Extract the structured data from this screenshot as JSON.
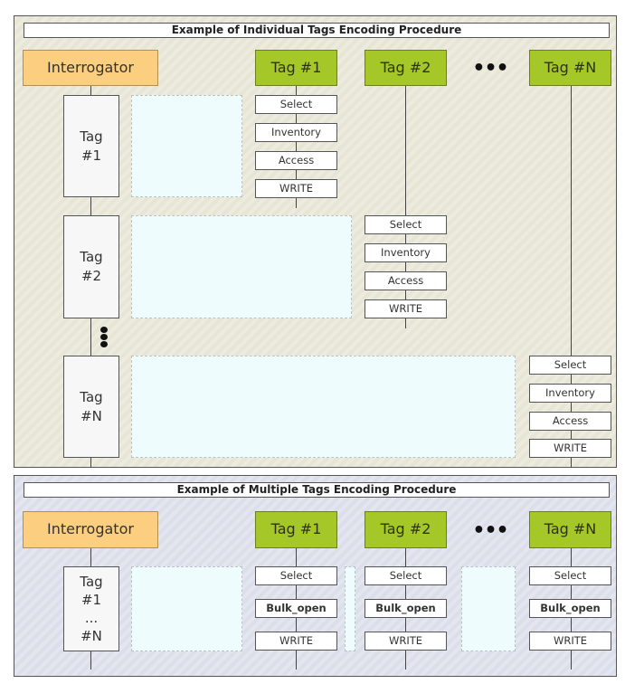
{
  "individual": {
    "title": "Example of Individual Tags Encoding Procedure",
    "headers": {
      "interrogator": "Interrogator",
      "tag1": "Tag #1",
      "tag2": "Tag #2",
      "ellipsis": "•••",
      "tagN": "Tag #N"
    },
    "activations": [
      {
        "line1": "Tag",
        "line2": "#1"
      },
      {
        "line1": "Tag",
        "line2": "#2"
      },
      {
        "line1": "Tag",
        "line2": "#N"
      }
    ],
    "commands": [
      "Select",
      "Inventory",
      "Access",
      "WRITE"
    ]
  },
  "multiple": {
    "title": "Example of Multiple Tags Encoding Procedure",
    "headers": {
      "interrogator": "Interrogator",
      "tag1": "Tag #1",
      "tag2": "Tag #2",
      "ellipsis": "•••",
      "tagN": "Tag #N"
    },
    "activation": {
      "line1": "Tag",
      "line2": "#1",
      "line3": "...",
      "line4": "#N"
    },
    "commands": [
      "Select",
      "Bulk_open",
      "WRITE"
    ]
  },
  "colors": {
    "interrogator": "#fbcf7f",
    "tag_header": "#a5c828",
    "dashed_fill": "#eefcfd",
    "top_panel_bg": "#ecebde",
    "bottom_panel_bg": "#e3e6ef"
  }
}
